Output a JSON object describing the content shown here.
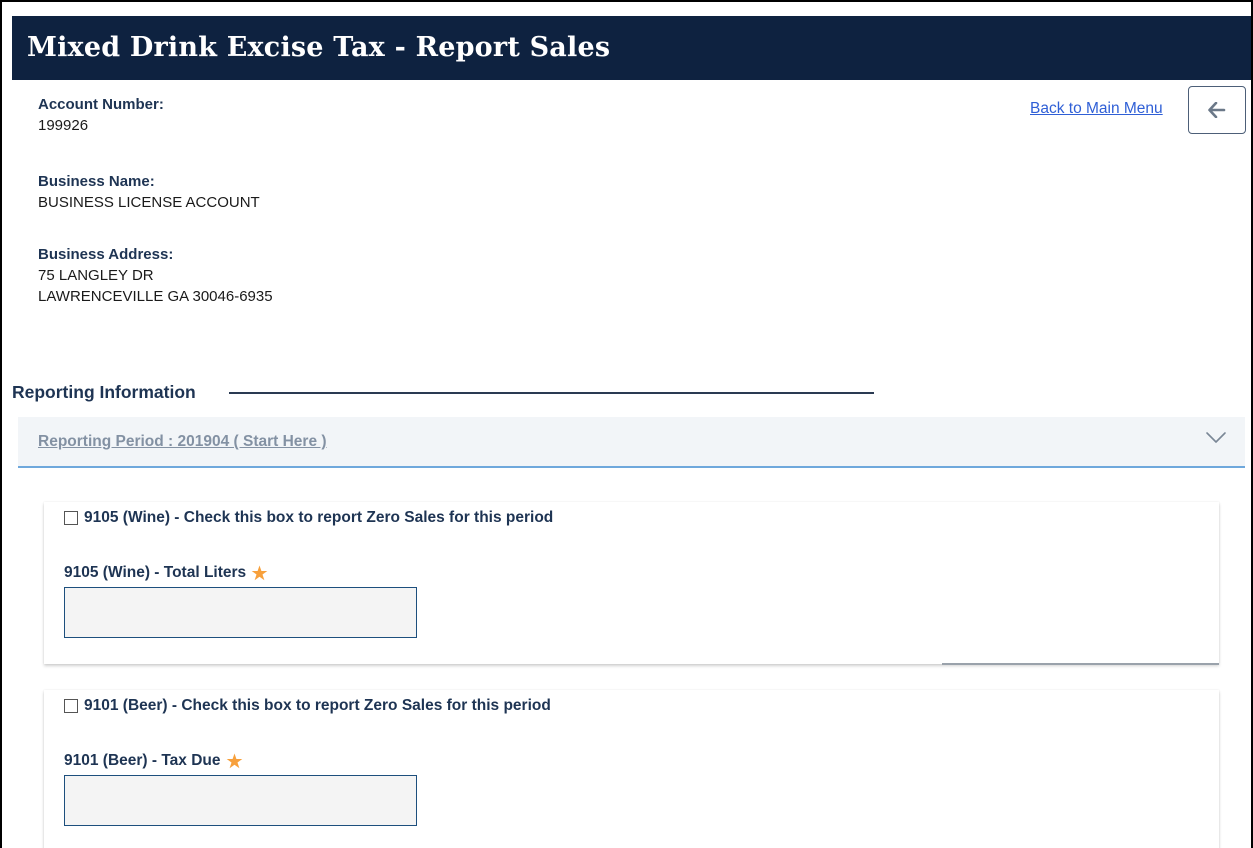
{
  "page": {
    "title": "Mixed Drink Excise Tax - Report Sales"
  },
  "account": {
    "number_label": "Account Number:",
    "number_value": "199926",
    "business_name_label": "Business Name:",
    "business_name_value": "BUSINESS LICENSE ACCOUNT",
    "address_label": "Business Address:",
    "address_line1": "75 LANGLEY DR",
    "address_line2": "LAWRENCEVILLE GA 30046-6935"
  },
  "nav": {
    "back_link": "Back to Main Menu",
    "back_icon": "arrow-left-icon"
  },
  "reporting": {
    "section_title": "Reporting Information",
    "period_header": "Reporting Period : 201904 ( Start Here )",
    "items": [
      {
        "zero_sales_label": "9105 (Wine) - Check this box to report Zero Sales for this period",
        "field_label": "9105 (Wine) - Total Liters",
        "value": "",
        "checked": false
      },
      {
        "zero_sales_label": "9101 (Beer) - Check this box to report Zero Sales for this period",
        "field_label": "9101 (Beer) - Tax Due",
        "value": "",
        "checked": false
      }
    ]
  },
  "colors": {
    "header_bg": "#0e2240",
    "required_star": "#f7a03c",
    "link": "#2f5fd6",
    "label_navy": "#1e3453",
    "accordion_border": "#6fa8dc"
  }
}
